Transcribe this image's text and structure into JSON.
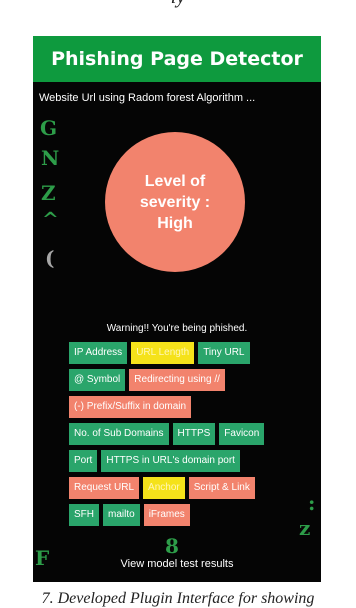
{
  "caption_top": "ly",
  "caption_bottom": "7. Developed Plugin Interface for showing",
  "header": {
    "title": "Phishing Page Detector"
  },
  "url_line": "Website Url using Radom forest Algorithm ...",
  "severity": {
    "text": "Level of severity : High"
  },
  "warning": "Warning!! You're being phished.",
  "colors": {
    "header": "#0e9a3e",
    "background": "#050505",
    "severity_circle": "#f2836d",
    "pass": "#2aa56b",
    "fail": "#f2836d",
    "warn": "#f5e21a"
  },
  "tests": [
    [
      {
        "label": "IP Address",
        "status": "pass"
      },
      {
        "label": "URL Length",
        "status": "warn"
      },
      {
        "label": "Tiny URL",
        "status": "pass"
      }
    ],
    [
      {
        "label": "@ Symbol",
        "status": "pass"
      },
      {
        "label": "Redirecting using //",
        "status": "fail"
      }
    ],
    [
      {
        "label": "(-) Prefix/Suffix in domain",
        "status": "fail"
      }
    ],
    [
      {
        "label": "No. of Sub Domains",
        "status": "pass"
      },
      {
        "label": "HTTPS",
        "status": "pass"
      },
      {
        "label": "Favicon",
        "status": "pass"
      }
    ],
    [
      {
        "label": "Port",
        "status": "pass"
      },
      {
        "label": "HTTPS in URL's domain port",
        "status": "pass"
      }
    ],
    [
      {
        "label": "Request URL",
        "status": "fail"
      },
      {
        "label": "Anchor",
        "status": "warn"
      },
      {
        "label": "Script & Link",
        "status": "fail"
      }
    ],
    [
      {
        "label": "SFH",
        "status": "pass"
      },
      {
        "label": "mailto",
        "status": "pass"
      },
      {
        "label": "iFrames",
        "status": "fail"
      }
    ]
  ],
  "footer_link": "View model test results"
}
